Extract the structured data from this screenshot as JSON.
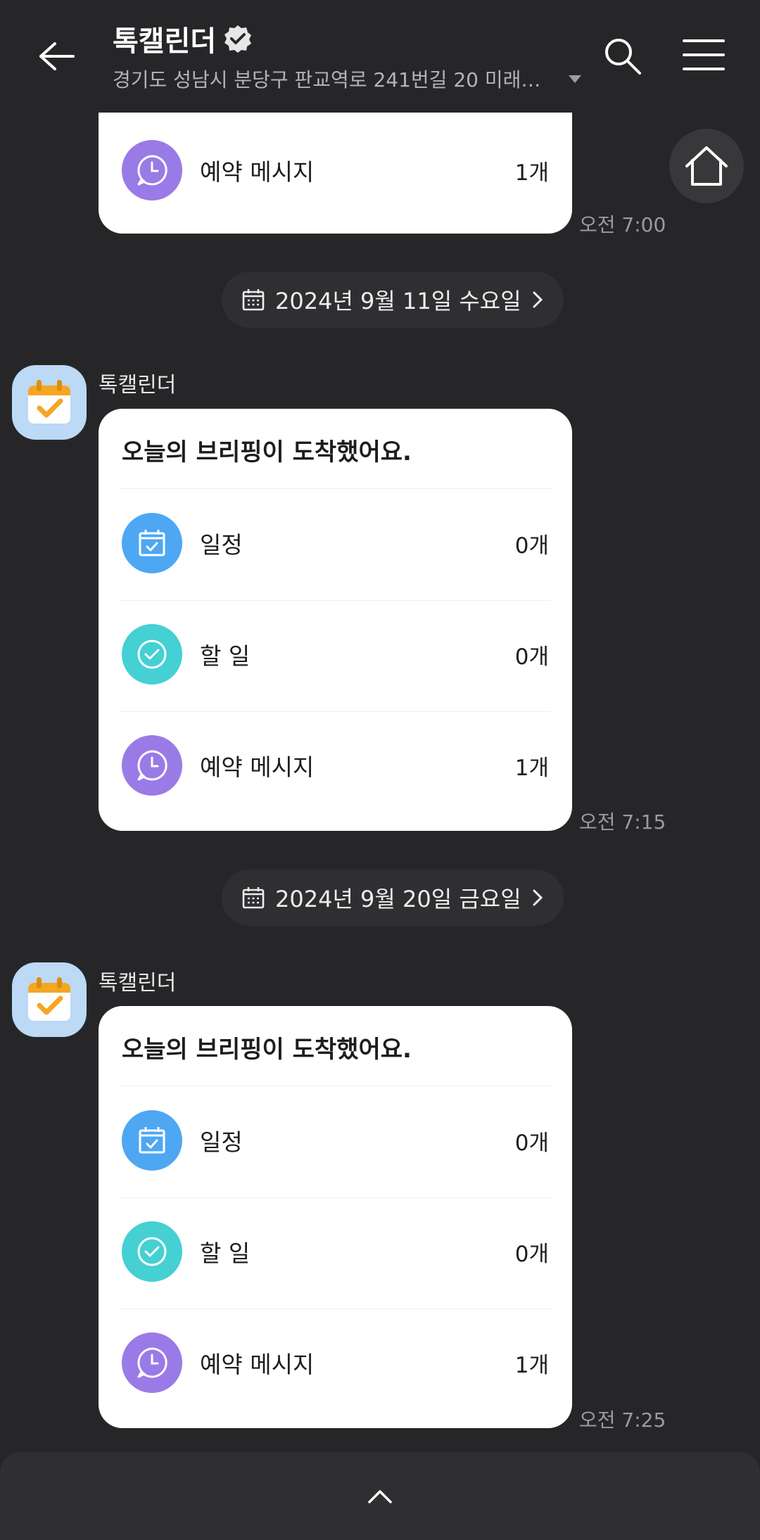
{
  "header": {
    "title": "톡캘린더",
    "subtitle": "경기도 성남시 분당구 판교역로 241번길 20 미래에..."
  },
  "card0": {
    "item_label": "예약 메시지",
    "item_count": "1개",
    "time": "오전 7:00"
  },
  "messages": [
    {
      "date": "2024년 9월 11일 수요일",
      "sender": "톡캘린더",
      "card_title": "오늘의 브리핑이 도착했어요.",
      "items": [
        {
          "label": "일정",
          "count": "0개",
          "icon": "calendar-icon"
        },
        {
          "label": "할 일",
          "count": "0개",
          "icon": "check-circle-icon"
        },
        {
          "label": "예약 메시지",
          "count": "1개",
          "icon": "clock-bubble-icon"
        }
      ],
      "time": "오전 7:15"
    },
    {
      "date": "2024년 9월 20일 금요일",
      "sender": "톡캘린더",
      "card_title": "오늘의 브리핑이 도착했어요.",
      "items": [
        {
          "label": "일정",
          "count": "0개",
          "icon": "calendar-icon"
        },
        {
          "label": "할 일",
          "count": "0개",
          "icon": "check-circle-icon"
        },
        {
          "label": "예약 메시지",
          "count": "1개",
          "icon": "clock-bubble-icon"
        }
      ],
      "time": "오전 7:25"
    }
  ],
  "colors": {
    "background": "#262629",
    "card": "#ffffff",
    "schedule_icon": "#4ea7f3",
    "todo_icon": "#45d0d3",
    "reserved_icon": "#9a7ae6"
  }
}
